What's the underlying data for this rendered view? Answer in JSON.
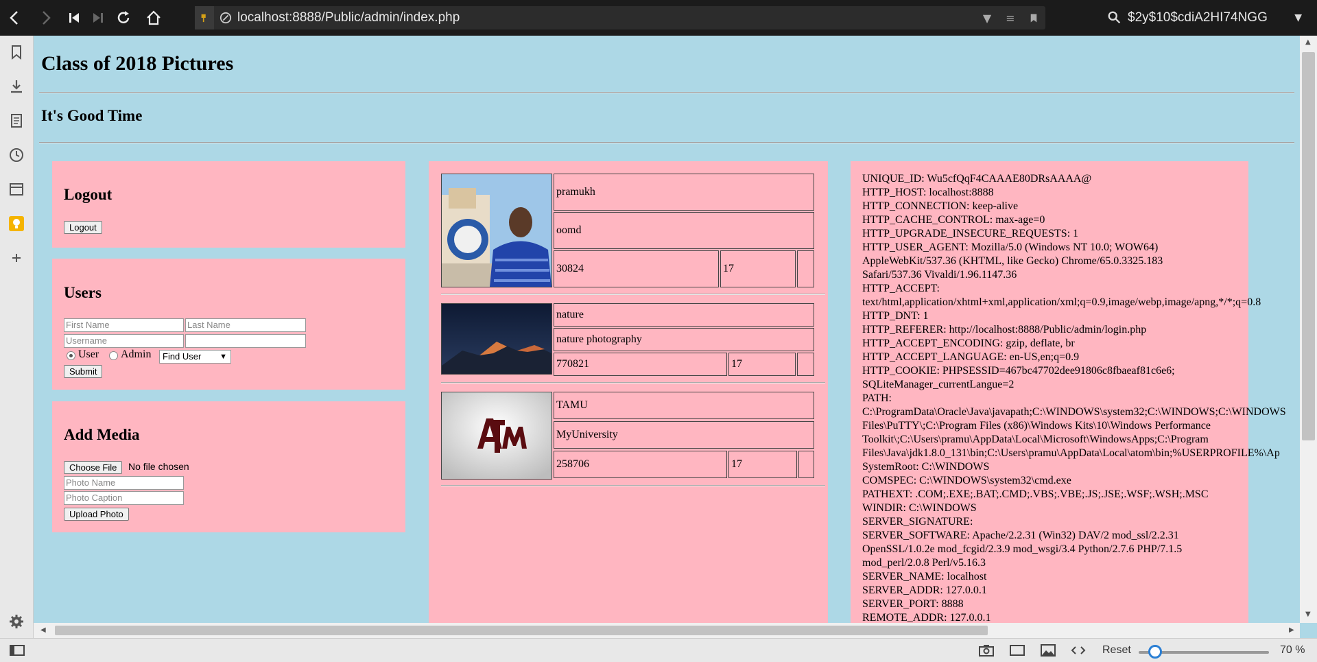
{
  "browser": {
    "url": "localhost:8888/Public/admin/index.php",
    "search_value": "$2y$10$cdiA2HI74NGG",
    "zoom_reset_label": "Reset",
    "zoom_level": "70 %",
    "accent_color": "#2a7fd4"
  },
  "page": {
    "title": "Class of 2018 Pictures",
    "subtitle": "It's Good Time",
    "background": "#add8e6",
    "panel_color": "#ffb6c1"
  },
  "logout_panel": {
    "heading": "Logout",
    "button": "Logout"
  },
  "users_panel": {
    "heading": "Users",
    "first_name_placeholder": "First Name",
    "last_name_placeholder": "Last Name",
    "username_placeholder": "Username",
    "radio_user": "User",
    "radio_admin": "Admin",
    "find_select": "Find User",
    "submit": "Submit"
  },
  "media_panel": {
    "heading": "Add Media",
    "choose_file": "Choose File",
    "no_file": "No file chosen",
    "photo_name_placeholder": "Photo Name",
    "photo_caption_placeholder": "Photo Caption",
    "upload": "Upload Photo"
  },
  "media_items": [
    {
      "name": "pramukh",
      "caption": "oomd",
      "id": "30824",
      "num": "17",
      "thumb": "portrait"
    },
    {
      "name": "nature",
      "caption": "nature photography",
      "id": "770821",
      "num": "17",
      "thumb": "mountain"
    },
    {
      "name": "TAMU",
      "caption": "MyUniversity",
      "id": "258706",
      "num": "17",
      "thumb": "atm-logo"
    }
  ],
  "server_info": [
    "UNIQUE_ID: Wu5cfQqF4CAAAE80DRsAAAA@",
    "HTTP_HOST: localhost:8888",
    "HTTP_CONNECTION: keep-alive",
    "HTTP_CACHE_CONTROL: max-age=0",
    "HTTP_UPGRADE_INSECURE_REQUESTS: 1",
    "HTTP_USER_AGENT: Mozilla/5.0 (Windows NT 10.0; WOW64)",
    "AppleWebKit/537.36 (KHTML, like Gecko) Chrome/65.0.3325.183",
    "Safari/537.36 Vivaldi/1.96.1147.36",
    "HTTP_ACCEPT:",
    "text/html,application/xhtml+xml,application/xml;q=0.9,image/webp,image/apng,*/*;q=0.8",
    "HTTP_DNT: 1",
    "HTTP_REFERER: http://localhost:8888/Public/admin/login.php",
    "HTTP_ACCEPT_ENCODING: gzip, deflate, br",
    "HTTP_ACCEPT_LANGUAGE: en-US,en;q=0.9",
    "HTTP_COOKIE: PHPSESSID=467bc47702dee91806c8fbaeaf81c6e6;",
    "SQLiteManager_currentLangue=2",
    "PATH:",
    "C:\\ProgramData\\Oracle\\Java\\javapath;C:\\WINDOWS\\system32;C:\\WINDOWS;C:\\WINDOWS",
    "Files\\PuTTY\\;C:\\Program Files (x86)\\Windows Kits\\10\\Windows Performance",
    "Toolkit\\;C:\\Users\\pramu\\AppData\\Local\\Microsoft\\WindowsApps;C:\\Program",
    "Files\\Java\\jdk1.8.0_131\\bin;C:\\Users\\pramu\\AppData\\Local\\atom\\bin;%USERPROFILE%\\Ap",
    "SystemRoot: C:\\WINDOWS",
    "COMSPEC: C:\\WINDOWS\\system32\\cmd.exe",
    "PATHEXT: .COM;.EXE;.BAT;.CMD;.VBS;.VBE;.JS;.JSE;.WSF;.WSH;.MSC",
    "WINDIR: C:\\WINDOWS",
    "SERVER_SIGNATURE:",
    "SERVER_SOFTWARE: Apache/2.2.31 (Win32) DAV/2 mod_ssl/2.2.31",
    "OpenSSL/1.0.2e mod_fcgid/2.3.9 mod_wsgi/3.4 Python/2.7.6 PHP/7.1.5",
    "mod_perl/2.0.8 Perl/v5.16.3",
    "SERVER_NAME: localhost",
    "SERVER_ADDR: 127.0.0.1",
    "SERVER_PORT: 8888",
    "REMOTE_ADDR: 127.0.0.1"
  ]
}
